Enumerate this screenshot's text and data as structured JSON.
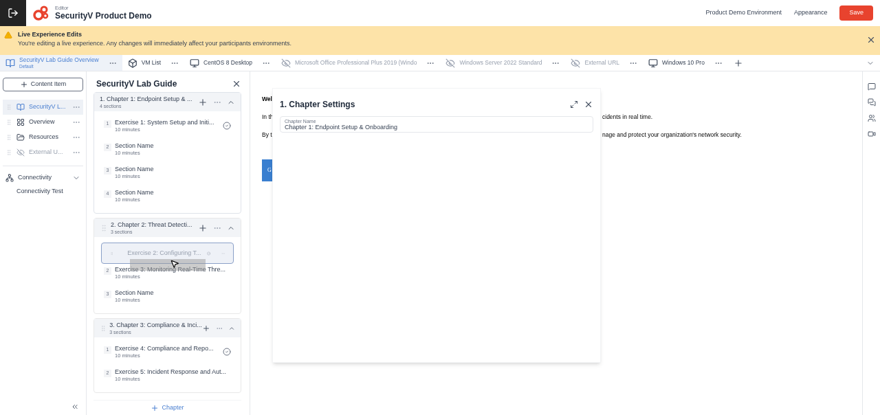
{
  "header": {
    "context": "Editor",
    "title": "SecurityV Product Demo",
    "links": [
      "Product Demo Environment",
      "Appearance"
    ],
    "save": "Save"
  },
  "banner": {
    "title": "Live Experience Edits",
    "message": "You're editing a live experience. Any changes will immediately affect your participants environments."
  },
  "tabs": [
    {
      "label": "SecurityV Lab Guide Overview",
      "subtitle": "Default",
      "kind": "guide",
      "disabled": false,
      "selected": true
    },
    {
      "label": "VM List",
      "kind": "list",
      "disabled": false,
      "selected": false
    },
    {
      "label": "CentOS 8 Desktop",
      "kind": "vm",
      "disabled": false,
      "selected": false
    },
    {
      "label": "Microsoft Office Professional Plus 2019 (Windo",
      "kind": "vm",
      "disabled": true,
      "selected": false
    },
    {
      "label": "Windows Server 2022 Standard",
      "kind": "vm",
      "disabled": true,
      "selected": false
    },
    {
      "label": "External URL",
      "kind": "url",
      "disabled": true,
      "selected": false
    },
    {
      "label": "Windows 10 Pro",
      "kind": "vm",
      "disabled": false,
      "selected": false
    }
  ],
  "sidebar": {
    "add_button": "Content Item",
    "items": [
      {
        "label": "SecurityV L...",
        "kind": "guide",
        "disabled": false,
        "selected": true
      },
      {
        "label": "Overview",
        "kind": "page",
        "disabled": false,
        "selected": false
      },
      {
        "label": "Resources",
        "kind": "files",
        "disabled": false,
        "selected": false
      },
      {
        "label": "External U...",
        "kind": "url",
        "disabled": true,
        "selected": false
      }
    ],
    "sections": [
      {
        "label": "Connectivity",
        "expanded": true,
        "children": [
          {
            "label": "Connectivity Test"
          }
        ]
      }
    ]
  },
  "lab_guide": {
    "title": "SecurityV Lab Guide",
    "add_chapter": "Chapter",
    "chapters": [
      {
        "title": "1. Chapter 1: Endpoint Setup & ...",
        "count": "4 sections",
        "expanded": true,
        "selected": true,
        "sections": [
          {
            "number": "1",
            "name": "Exercise 1: System Setup and Initi...",
            "duration": "10 minutes",
            "completed": true,
            "dragging": false
          },
          {
            "number": "2",
            "name": "Section Name",
            "duration": "10 minutes",
            "completed": false,
            "dragging": false
          },
          {
            "number": "3",
            "name": "Section Name",
            "duration": "10 minutes",
            "completed": false,
            "dragging": false
          },
          {
            "number": "4",
            "name": "Section Name",
            "duration": "10 minutes",
            "completed": false,
            "dragging": false
          }
        ]
      },
      {
        "title": "2. Chapter 2: Threat Detecti...",
        "count": "3 sections",
        "expanded": true,
        "selected": false,
        "sections": [
          {
            "name": "Exercise 2: Configuring T...",
            "completed": true,
            "dragging": true
          },
          {
            "number": "2",
            "name": "Exercise 3: Monitoring Real-Time Thre...",
            "duration": "10 minutes",
            "completed": false,
            "dragging": false
          },
          {
            "number": "3",
            "name": "Section Name",
            "duration": "10 minutes",
            "completed": false,
            "dragging": false
          }
        ]
      },
      {
        "title": "3. Chapter 3: Compliance & Inci...",
        "count": "3 sections",
        "expanded": true,
        "selected": false,
        "sections": [
          {
            "number": "1",
            "name": "Exercise 4: Compliance and Repo...",
            "duration": "10 minutes",
            "completed": true,
            "dragging": false
          },
          {
            "number": "2",
            "name": "Exercise 5: Incident Response and Aut...",
            "duration": "10 minutes",
            "completed": false,
            "dragging": false
          }
        ]
      }
    ]
  },
  "content": {
    "rows": [
      {
        "left": "Wel"
      },
      {
        "left": "In th",
        "right": "cidents in real time."
      },
      {
        "left": "By t",
        "right": "nage and protect your organization's network security."
      }
    ],
    "button": "G"
  },
  "settings_panel": {
    "title": "1. Chapter Settings",
    "field_label": "Chapter Name",
    "field_value": "Chapter 1: Endpoint Setup & Onboarding"
  }
}
